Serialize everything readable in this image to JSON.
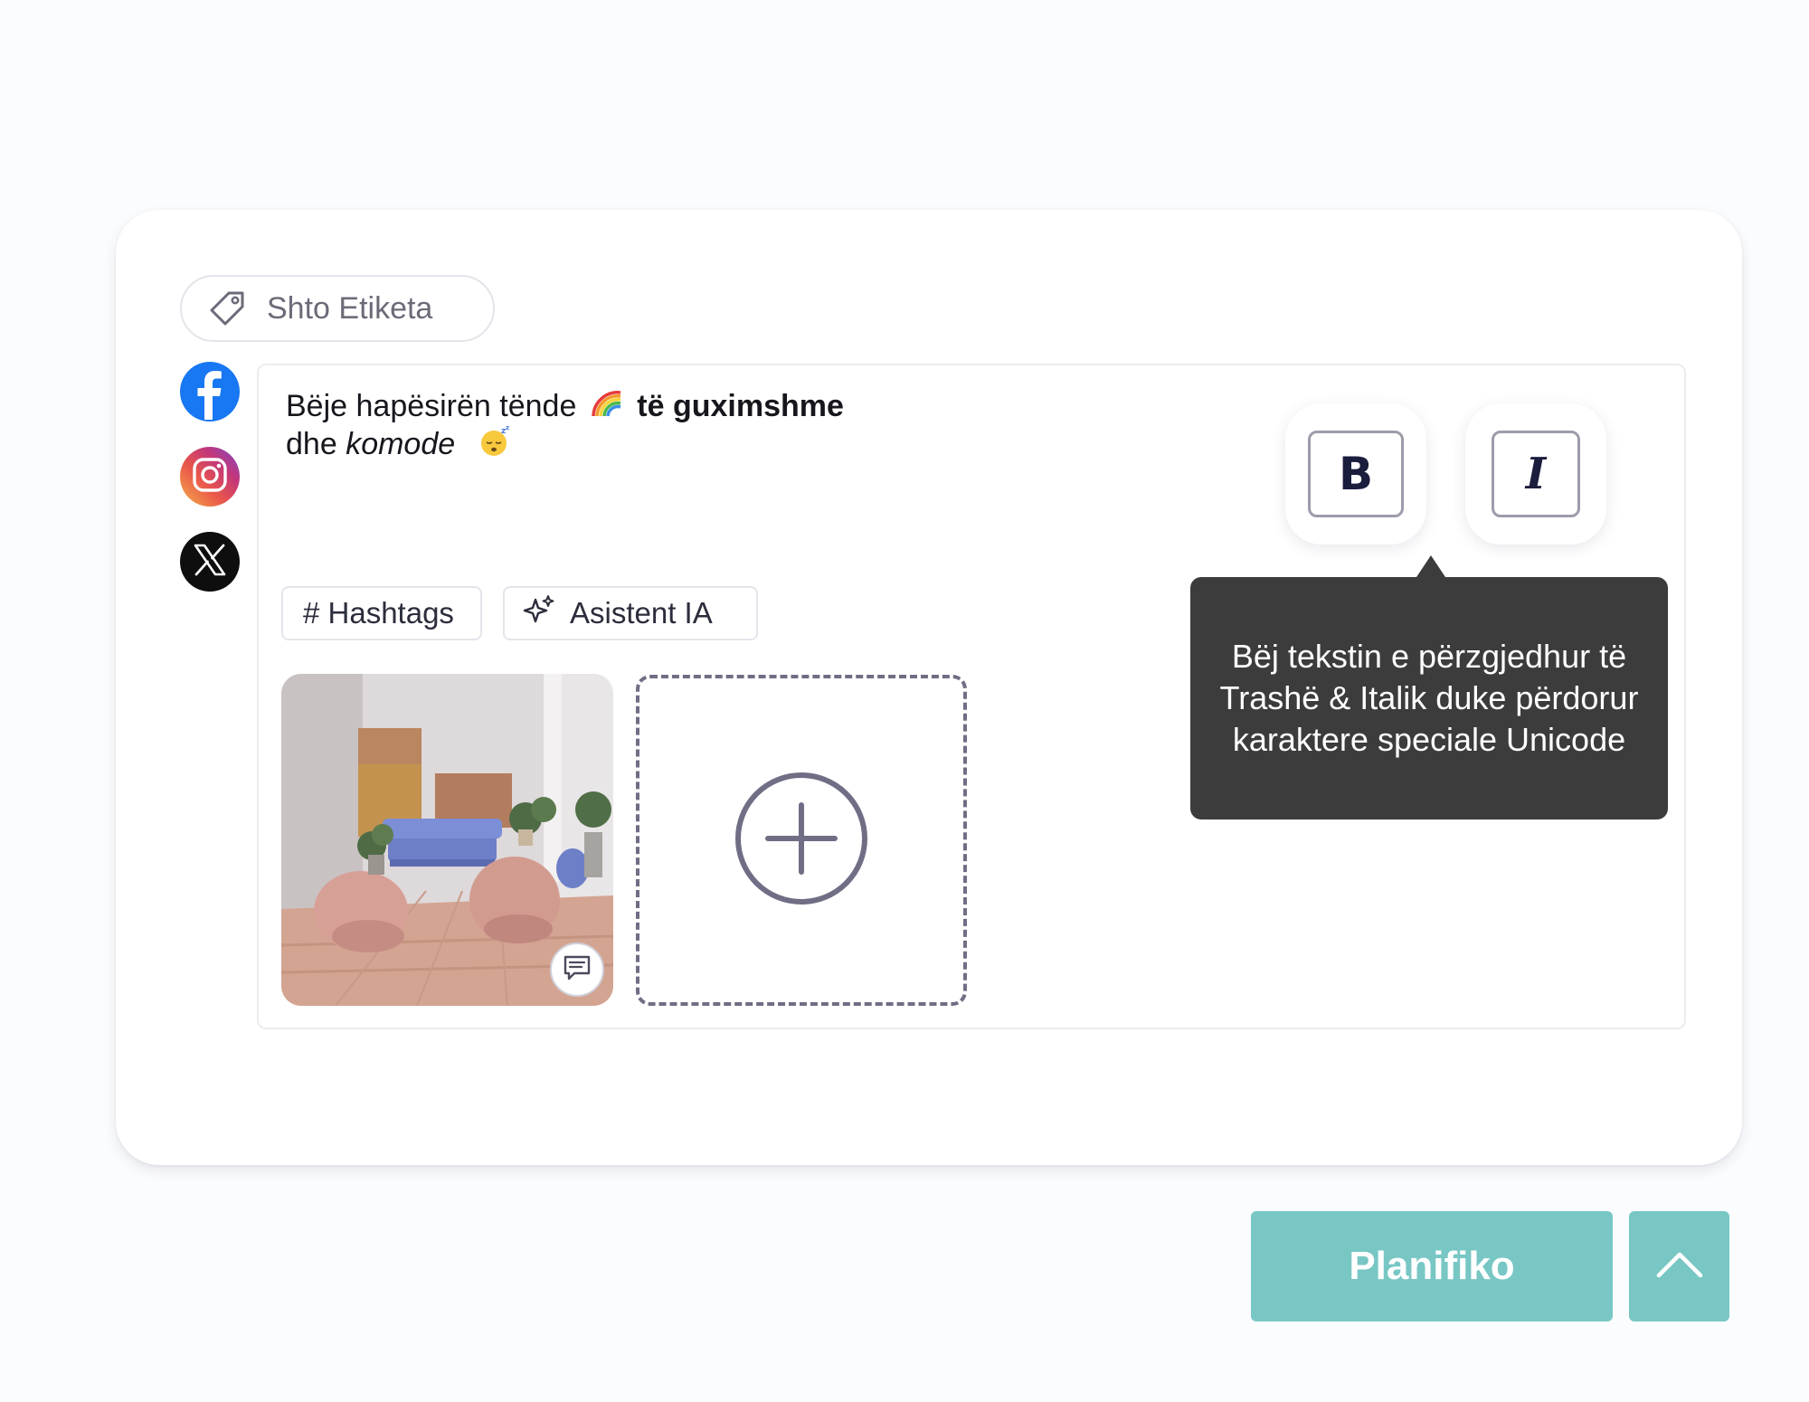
{
  "tags_button": {
    "label": "Shto Etiketa",
    "icon": "tag-icon"
  },
  "social_accounts": [
    {
      "network": "Facebook",
      "icon": "facebook-icon",
      "color": "#1877f2"
    },
    {
      "network": "Instagram",
      "icon": "instagram-icon",
      "color": "#e1306c"
    },
    {
      "network": "X",
      "icon": "x-icon",
      "color": "#0e0e0e"
    }
  ],
  "post": {
    "line1_plain": "Bëje hapësirën tënde",
    "line1_emoji": "rainbow",
    "line1_bold": "të guximshme",
    "line2_plain": "dhe",
    "line2_italic": "komode",
    "line2_emoji": "sleeping-face"
  },
  "chips": {
    "hashtags_label": "# Hashtags",
    "assistant_label": "Asistent IA",
    "assistant_icon": "sparkles-icon"
  },
  "media": {
    "thumbnail": "living-room-photo",
    "comment_icon": "comment-icon",
    "add_icon": "plus-circle-icon"
  },
  "format_buttons": {
    "bold_label": "B",
    "italic_label": "I"
  },
  "tooltip": {
    "text": "Bëj tekstin e përzgjedhur të Trashë & Italik duke përdorur karaktere speciale Unicode"
  },
  "actions": {
    "schedule_label": "Planifiko",
    "expand_icon": "chevron-up-icon"
  },
  "colors": {
    "accent": "#78c7c5",
    "tooltip_bg": "#3c3c3c",
    "text": "#16161d"
  }
}
